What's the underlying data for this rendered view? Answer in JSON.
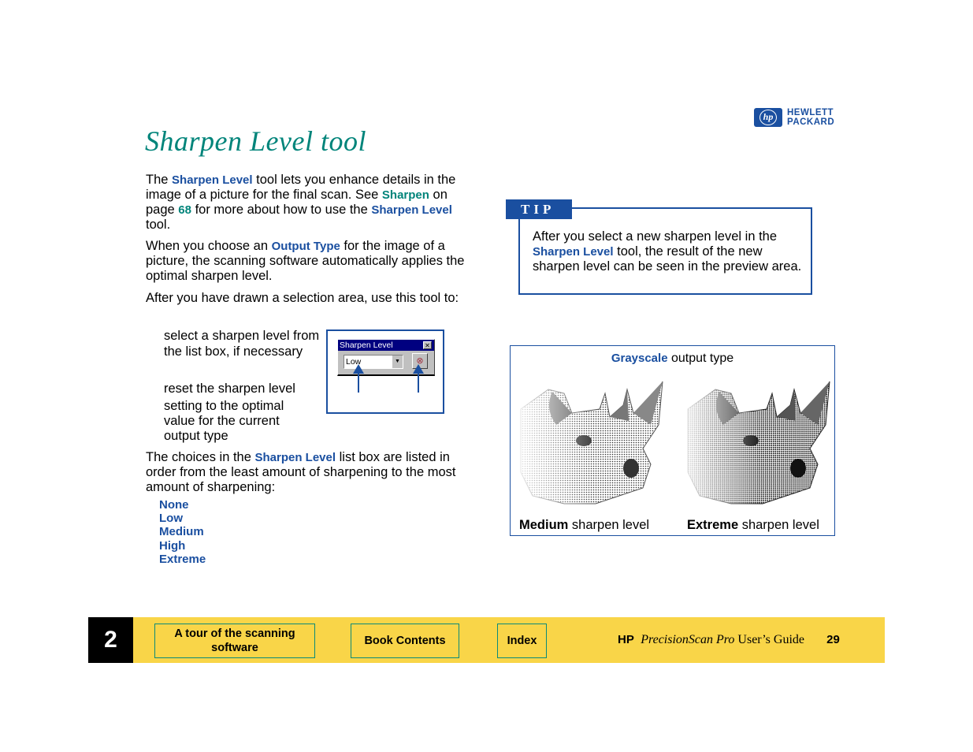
{
  "page": {
    "title": "Sharpen Level tool",
    "logo": {
      "icon": "hp-logo-icon",
      "line1": "HEWLETT",
      "line2": "PACKARD",
      "mark": "hp",
      "color": "#1a4fa0"
    }
  },
  "body": {
    "para1": {
      "t1": "The ",
      "link1": "Sharpen Level",
      "t2": " tool lets you enhance details in the image of a picture for the final scan. See ",
      "link2": "Sharpen",
      "t3": " on page ",
      "link3": "68",
      "t4": " for more about how to use the ",
      "link4": "Sharpen Level",
      "t5": " tool."
    },
    "para2": {
      "t1": "When you choose an ",
      "link1": "Output Type",
      "t2": " for the image of a picture, the scanning software automatically applies the optimal sharpen level."
    },
    "para3": "After you have drawn a selection area, use this tool to:",
    "bullet1": "select a sharpen level from the list box, if necessary",
    "bullet2a": "reset the sharpen level",
    "bullet2b": "setting to the optimal value for the current output type",
    "para4": {
      "t1": "The choices in the ",
      "link1": "Sharpen Level",
      "t2": " list box are listed in order from the least amount of sharpening to the most amount of sharpening:"
    },
    "levels": [
      "None",
      "Low",
      "Medium",
      "High",
      "Extreme"
    ]
  },
  "tool_widget": {
    "window_title": "Sharpen Level",
    "close_glyph": "✕",
    "selected_value": "Low",
    "dropdown_glyph": "▼",
    "reset_icon": "reset-icon"
  },
  "tip": {
    "label": "TIP",
    "t1": "After you select a new sharpen level in the ",
    "link1": "Sharpen Level",
    "t2": " tool, the result of the new sharpen level can be seen in the preview area."
  },
  "figure": {
    "title_link": "Grayscale",
    "title_rest": " output type",
    "left_caption_bold": "Medium",
    "left_caption_rest": " sharpen level",
    "right_caption_bold": "Extreme",
    "right_caption_rest": " sharpen level"
  },
  "footer": {
    "chapter": "2",
    "btn_tour": "A tour of the scanning software",
    "btn_contents": "Book Contents",
    "btn_index": "Index",
    "guide_hp": "HP",
    "guide_product": "PrecisionScan Pro",
    "guide_rest": " User’s Guide",
    "page_number": "29",
    "bg_color": "#f9d548"
  }
}
